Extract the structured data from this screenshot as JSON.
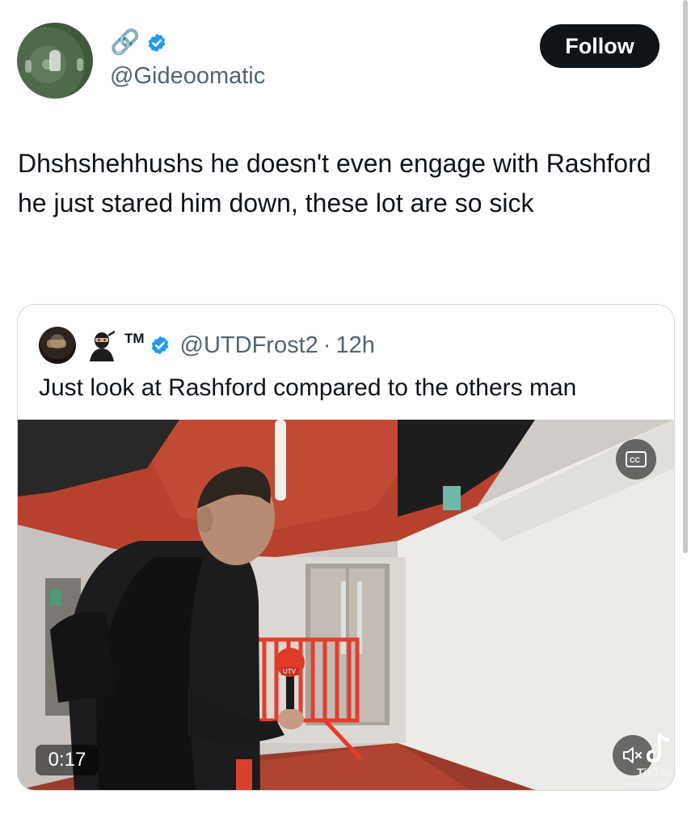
{
  "author": {
    "display_name": "🔗",
    "handle": "@Gideoomatic",
    "verified": true
  },
  "follow_button": {
    "label": "Follow"
  },
  "tweet": {
    "text": "Dhshshehhushs he doesn't even engage with Rashford he just stared him down, these lot are so sick"
  },
  "quoted_tweet": {
    "author_suffix": "TM",
    "handle": "@UTDFrost2",
    "separator": "·",
    "time_ago": "12h",
    "text": "Just look at Rashford compared to the others man",
    "video": {
      "duration": "0:17",
      "cc_label": "CC",
      "watermark_brand": "TikTok",
      "watermark_user": "foreverunited",
      "mic_logo": "UTV"
    }
  },
  "colors": {
    "verified_blue": "#1d9bf0",
    "follow_bg": "#0f1419",
    "secondary_text": "#536471"
  }
}
